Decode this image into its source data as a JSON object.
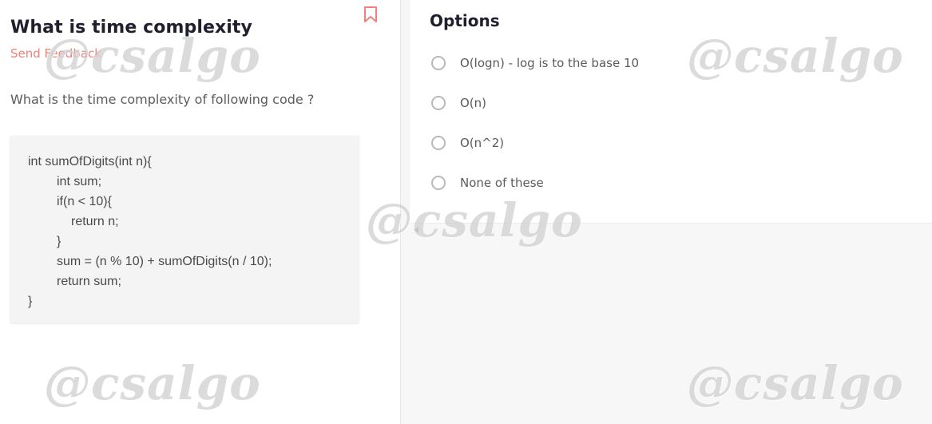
{
  "question": {
    "title": "What is time complexity",
    "feedback_label": "Send Feedback",
    "prompt": "What is the time complexity of following code ?",
    "code_lines": [
      "int sumOfDigits(int n){",
      "int sum;",
      "if(n < 10){",
      "return n;",
      "}",
      "sum = (n % 10) + sumOfDigits(n / 10);",
      "return sum;",
      "}"
    ]
  },
  "options": {
    "title": "Options",
    "items": [
      "O(logn) - log is to the base 10",
      "O(n)",
      "O(n^2)",
      "None of these"
    ]
  },
  "watermark": "@csalgo",
  "colors": {
    "accent": "#f0807a",
    "title": "#1f1f2e",
    "body_text": "#5b5b5b",
    "code_bg": "#f4f4f4"
  },
  "icons": {
    "bookmark": "bookmark-icon",
    "collapse": "chevron-left-icon"
  }
}
